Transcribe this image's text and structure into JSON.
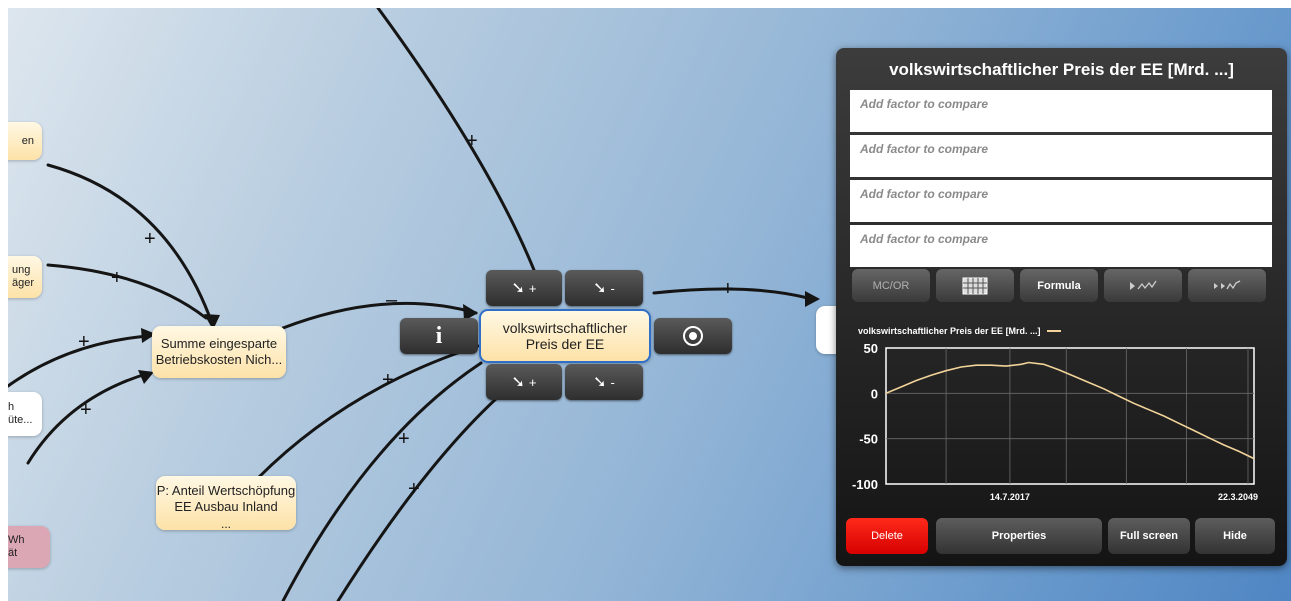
{
  "nodes": {
    "top_left_clip": "en",
    "left_mid_clip": "ung\näger",
    "left_white_clip": "h\nüte...",
    "left_pink_clip": "Wh\nät",
    "summe": "Summe eingesparte\nBetriebskosten Nich...",
    "anteil": "P: Anteil Wertschöpfung\nEE Ausbau Inland",
    "anteil_more": "...",
    "selected": "volkswirtschaftlicher\nPreis der EE"
  },
  "edge_signs": {
    "plus": "+",
    "minus": "–"
  },
  "node_toolbar": {
    "arrow_glyph": "➘",
    "plus": "+",
    "minus": "-",
    "info": "i"
  },
  "panel": {
    "title": "volkswirtschaftlicher Preis der EE [Mrd. ...]",
    "factor_placeholder": "Add factor to compare",
    "toolbar": {
      "mcor": "MC/OR",
      "table_icon": "grid-icon",
      "formula": "Formula",
      "sim1": "▸⩘⁄",
      "sim2": "▸⌃▸⁄"
    },
    "buttons": {
      "delete": "Delete",
      "properties": "Properties",
      "full_screen": "Full screen",
      "hide": "Hide"
    }
  },
  "colors": {
    "node_fill": "#fde2a8",
    "selection": "#2f6fc8",
    "delete_red": "#f01a10",
    "line": "#f2d49a"
  },
  "chart_data": {
    "type": "line",
    "legend": "volkswirtschaftlicher Preis der EE [Mrd. ...]",
    "xtick_labels": [
      "14.7.2017",
      "22.3.2049"
    ],
    "ytick_labels": [
      "50",
      "0",
      "-50",
      "-100"
    ],
    "ylim": [
      -100,
      50
    ],
    "xlim_year": [
      2001.0,
      2050.0
    ],
    "grid": true,
    "series": [
      {
        "x": [
          2001.0,
          2003,
          2005,
          2007,
          2009,
          2011,
          2013,
          2015,
          2017,
          2019,
          2020,
          2022,
          2024,
          2026,
          2028,
          2030,
          2032,
          2034,
          2036,
          2038,
          2040,
          2042,
          2044,
          2046,
          2048,
          2050
        ],
        "values": [
          0,
          7,
          14,
          20,
          25,
          29,
          31,
          31,
          30,
          32,
          34,
          32,
          26,
          19,
          12,
          5,
          -3,
          -11,
          -18,
          -25,
          -33,
          -41,
          -49,
          -57,
          -64,
          -72
        ]
      }
    ]
  }
}
